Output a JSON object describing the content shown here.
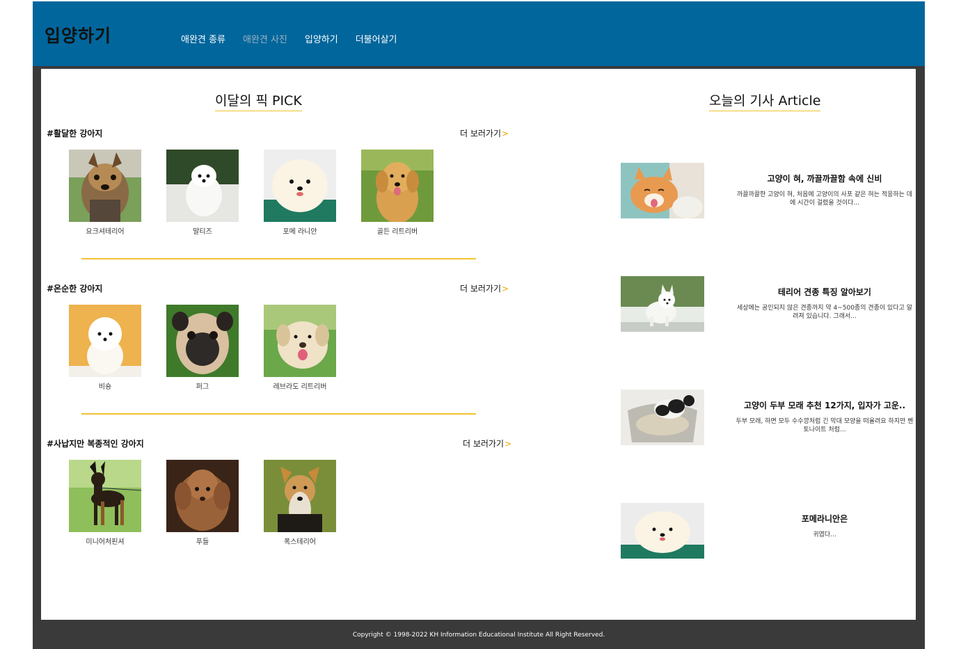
{
  "header": {
    "logo": "입양하기",
    "nav": [
      "애완견 종류",
      "애완견 사진",
      "입양하기",
      "더불어살기"
    ]
  },
  "pick": {
    "title": "이달의 픽 PICK",
    "more_label": "더 보러가기",
    "more_arrow": ">",
    "categories": [
      {
        "title": "#활달한 강아지",
        "dogs": [
          {
            "name": "요크셔테리어",
            "icon": "yorkshire-terrier"
          },
          {
            "name": "말티즈",
            "icon": "maltese"
          },
          {
            "name": "포메 라니안",
            "icon": "pomeranian"
          },
          {
            "name": "골든 리트리버",
            "icon": "golden-retriever"
          }
        ]
      },
      {
        "title": "#온순한 강아지",
        "dogs": [
          {
            "name": "비숑",
            "icon": "bichon"
          },
          {
            "name": "퍼그",
            "icon": "pug"
          },
          {
            "name": "레브라도 리트리버",
            "icon": "labrador-retriever"
          }
        ]
      },
      {
        "title": "#사납지만 복종적인 강아지",
        "dogs": [
          {
            "name": "미니어처핀셔",
            "icon": "miniature-pinscher"
          },
          {
            "name": "푸들",
            "icon": "poodle"
          },
          {
            "name": "폭스테리어",
            "icon": "fox-terrier"
          }
        ]
      }
    ]
  },
  "article": {
    "title": "오늘의 기사 Article",
    "items": [
      {
        "title": "고양이 혀, 까끌까끌함 속에 신비",
        "desc": "까끌까끌한 고양이 혀, 처음에 고양이의 사포 같은 혀는 적응하는 데에 시간이 걸렸을 것이다...",
        "icon": "cat-licking"
      },
      {
        "title": "테리어 견종 특징 알아보기",
        "desc": "세상에는 공인되지 않은 견종까지 약 4~500종의 견종이 있다고 알려져 있습니다. 그래서...",
        "icon": "westie"
      },
      {
        "title": "고양이 두부 모래 추천 12가지, 입자가 고운..",
        "desc": "두부 모래, 하면 모두 수수깡처럼 긴 막대 모양을 떠올려요 하지만 벤토나이트 처럼...",
        "icon": "cat-litter"
      },
      {
        "title": "포메라니안은",
        "desc": "귀엽다...",
        "icon": "pomeranian"
      }
    ]
  },
  "footer": {
    "copyright": "Copyright © 1998-2022 KH Information Educational Institute All Right Reserved."
  },
  "colors": {
    "header": "#00669c",
    "frame": "#3a3a3a",
    "accent": "#f2c230"
  }
}
